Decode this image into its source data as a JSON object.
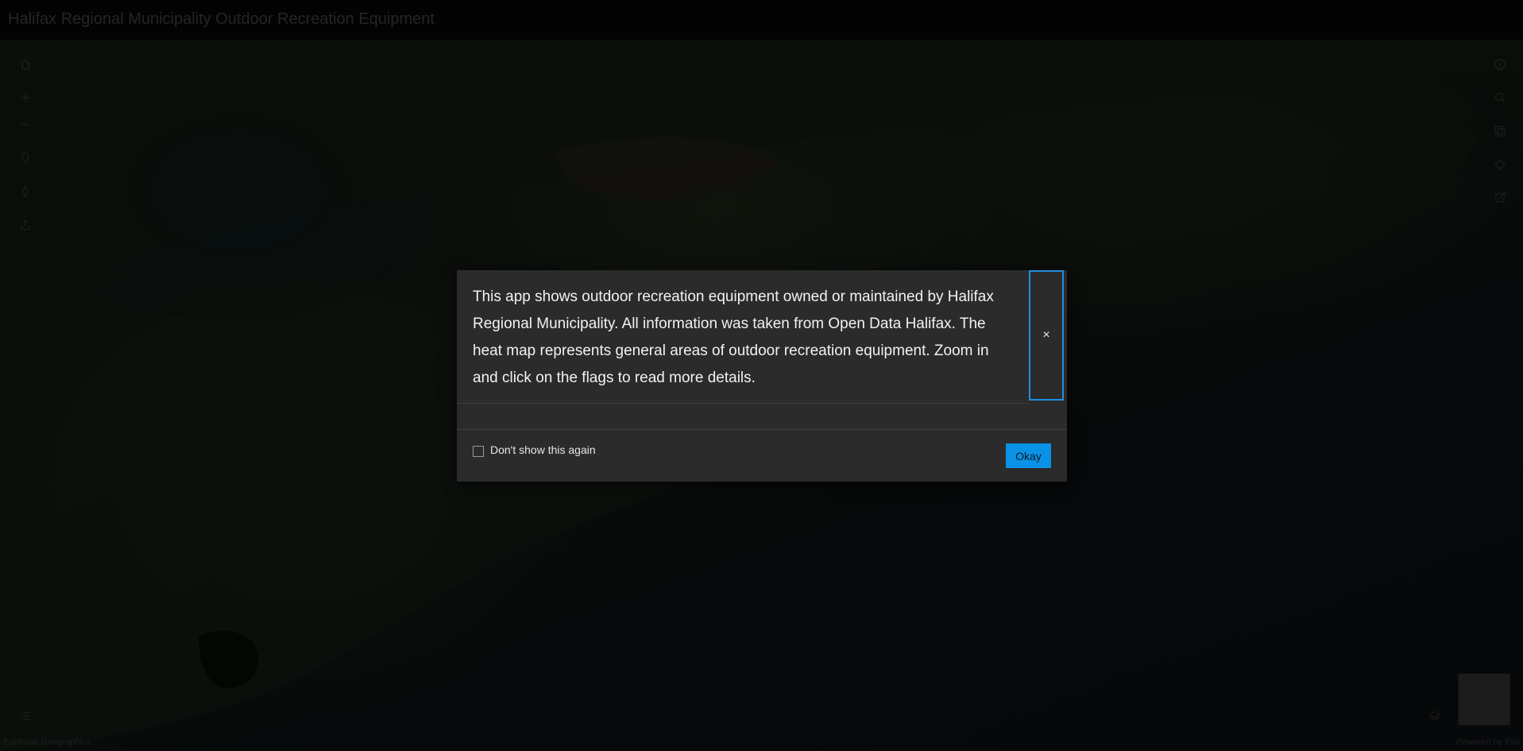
{
  "header": {
    "title": "Halifax Regional Municipality Outdoor Recreation Equipment"
  },
  "map": {
    "left_tools": [
      "home-icon",
      "zoom-in-icon",
      "zoom-out-icon",
      "locate-icon",
      "compass-icon",
      "share-icon"
    ],
    "right_tools": [
      "info-icon",
      "search-icon",
      "basemap-gallery-icon",
      "bookmark-icon",
      "export-icon"
    ],
    "attribution_left": "Earthstar Geographics",
    "attribution_right": "Powered by Esri"
  },
  "modal": {
    "message": "This app shows outdoor recreation equipment owned or maintained by Halifax Regional Municipality. All information was taken from Open Data Halifax. The heat map represents general areas of outdoor recreation equipment. Zoom in and click on the flags to read more details.",
    "close_label": "×",
    "checkbox_label": "Don't show this again",
    "checkbox_checked": false,
    "okay_label": "Okay"
  },
  "colors": {
    "accent": "#0a93e6",
    "modal_bg": "#2b2b2b",
    "header_bg": "#050505"
  }
}
